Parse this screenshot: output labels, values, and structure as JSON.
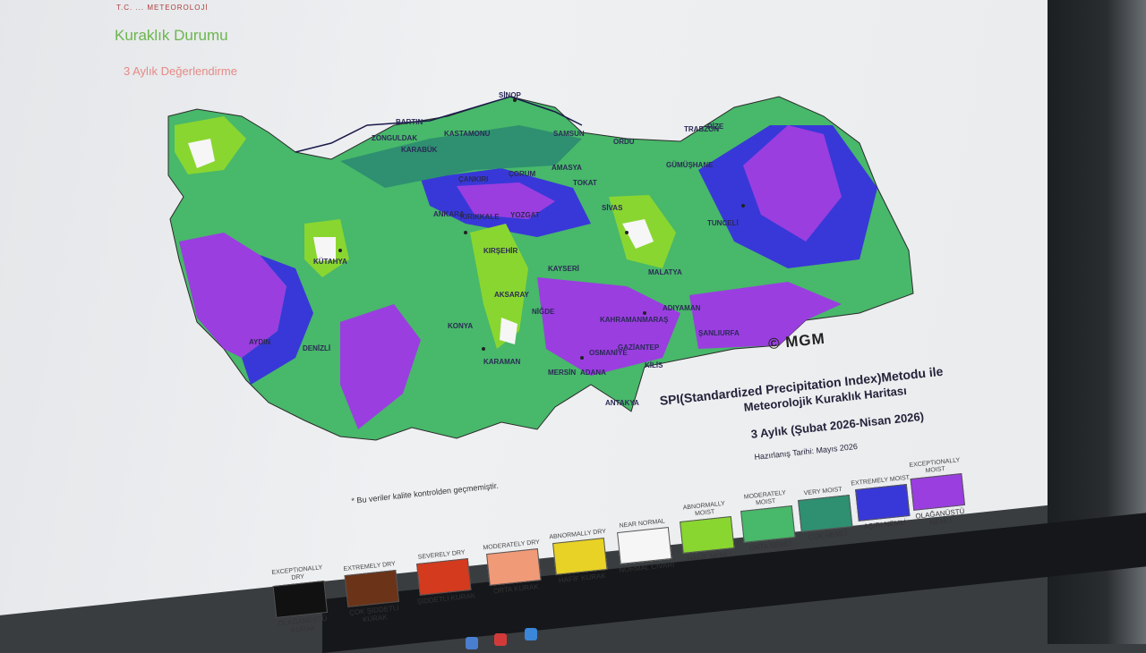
{
  "header": {
    "logos": "T.C. ...  METEOROLOJİ"
  },
  "page": {
    "title": "Kuraklık Durumu",
    "subtitle": "3 Aylık Değerlendirme"
  },
  "map": {
    "copyright": "© MGM",
    "title_line1": "SPI(Standardized Precipitation Index)Metodu ile",
    "title_line2": "Meteorolojik Kuraklık Haritası",
    "title_line3": "3 Aylık (Şubat 2026-Nisan 2026)",
    "prepared_date": "Hazırlanış Tarihi: Mayıs 2026",
    "note": "* Bu veriler kalite kontrolden geçmemiştir.",
    "cities": [
      {
        "name": "SİNOP"
      },
      {
        "name": "BARTIN"
      },
      {
        "name": "ZONGULDAK"
      },
      {
        "name": "KASTAMONU"
      },
      {
        "name": "KARABÜK"
      },
      {
        "name": "SAMSUN"
      },
      {
        "name": "ORDU"
      },
      {
        "name": "TRABZON"
      },
      {
        "name": "RİZE"
      },
      {
        "name": "GÜMÜŞHANE"
      },
      {
        "name": "ÇORUM"
      },
      {
        "name": "AMASYA"
      },
      {
        "name": "ÇANKIRI"
      },
      {
        "name": "TOKAT"
      },
      {
        "name": "ANKARA"
      },
      {
        "name": "KIRIKKALE"
      },
      {
        "name": "YOZGAT"
      },
      {
        "name": "SİVAS"
      },
      {
        "name": "TUNCELİ"
      },
      {
        "name": "KÜTAHYA"
      },
      {
        "name": "KIRŞEHİR"
      },
      {
        "name": "KAYSERİ"
      },
      {
        "name": "MALATYA"
      },
      {
        "name": "AKSARAY"
      },
      {
        "name": "NİĞDE"
      },
      {
        "name": "KONYA"
      },
      {
        "name": "ADIYAMAN"
      },
      {
        "name": "KAHRAMANMARAŞ"
      },
      {
        "name": "OSMANİYE"
      },
      {
        "name": "GAZİANTEP"
      },
      {
        "name": "ŞANLIURFA"
      },
      {
        "name": "KİLİS"
      },
      {
        "name": "MERSİN"
      },
      {
        "name": "ADANA"
      },
      {
        "name": "KARAMAN"
      },
      {
        "name": "ANTAKYA"
      },
      {
        "name": "AYDIN"
      },
      {
        "name": "DENİZLİ"
      }
    ]
  },
  "legend": [
    {
      "en": "EXCEPTIONALLY DRY",
      "tr": "OLAĞANÜSTÜ KURAK",
      "color": "#111111"
    },
    {
      "en": "EXTREMELY DRY",
      "tr": "ÇOK ŞİDDETLİ KURAK",
      "color": "#6b3318"
    },
    {
      "en": "SEVERELY DRY",
      "tr": "ŞİDDETLİ KURAK",
      "color": "#d33a1e"
    },
    {
      "en": "MODERATELY DRY",
      "tr": "ORTA KURAK",
      "color": "#f09a78"
    },
    {
      "en": "ABNORMALLY DRY",
      "tr": "HAFİF KURAK",
      "color": "#e8d226"
    },
    {
      "en": "NEAR NORMAL",
      "tr": "NORMAL CİVARI",
      "color": "#f6f6f6"
    },
    {
      "en": "ABNORMALLY MOIST",
      "tr": "HAFİF NEMLİ",
      "color": "#8ad630"
    },
    {
      "en": "MODERATELY MOIST",
      "tr": "ORTA NEMLİ",
      "color": "#48b86a"
    },
    {
      "en": "VERY MOIST",
      "tr": "ÇOK NEMLİ",
      "color": "#2e9070"
    },
    {
      "en": "EXTREMELY MOIST",
      "tr": "AŞIRI NEMLİ",
      "color": "#3838d8"
    },
    {
      "en": "EXCEPTIONALLY MOIST",
      "tr": "OLAĞANÜSTÜ NEMLİ",
      "color": "#9a3ee0"
    }
  ]
}
